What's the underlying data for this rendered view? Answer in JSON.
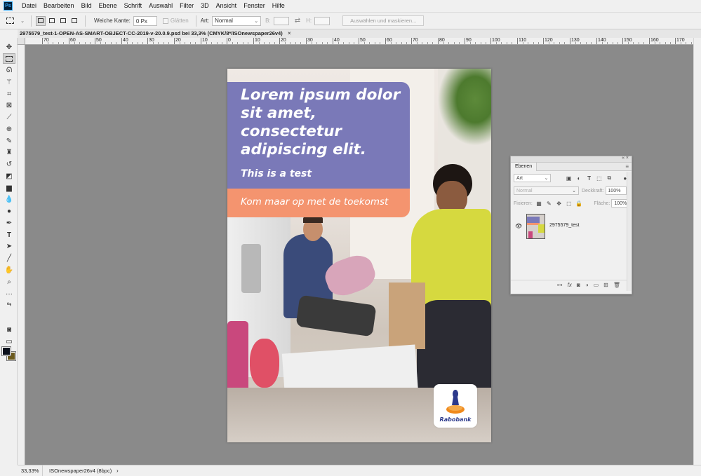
{
  "app": {
    "logo": "Ps"
  },
  "menu": [
    "Datei",
    "Bearbeiten",
    "Bild",
    "Ebene",
    "Schrift",
    "Auswahl",
    "Filter",
    "3D",
    "Ansicht",
    "Fenster",
    "Hilfe"
  ],
  "options": {
    "feather_label": "Weiche Kante:",
    "feather_value": "0 Px",
    "antialias_label": "Glätten",
    "style_label": "Art:",
    "style_value": "Normal",
    "width_label": "B:",
    "height_label": "H:",
    "select_mask_button": "Auswählen und maskieren..."
  },
  "document": {
    "tab_title": "2975579_test-1-OPEN-AS-SMART-OBJECT-CC-2019-v-20.0.9.psd bei 33,3% (CMYK/8*/ISOnewspaper26v4)",
    "close": "×"
  },
  "ruler": {
    "labels": [
      "70",
      "60",
      "50",
      "40",
      "30",
      "20",
      "10",
      "0",
      "10",
      "20",
      "30",
      "40",
      "50",
      "60",
      "70",
      "80",
      "90",
      "100",
      "110",
      "120",
      "130",
      "140",
      "150",
      "160",
      "170"
    ]
  },
  "artwork": {
    "headline": "Lorem ipsum dolor sit amet, consectetur adipiscing elit.",
    "subline": "This is a test",
    "cta": "Kom maar op met de toekomst",
    "logo_text": "Rabobank",
    "colors": {
      "headline_box": "#7a79b8",
      "cta_box": "#f4946f",
      "logo_text": "#2c3a8c"
    }
  },
  "layers_panel": {
    "tab": "Ebenen",
    "filter_value": "Art",
    "blend_mode": "Normal",
    "opacity_label": "Deckkraft:",
    "opacity_value": "100%",
    "lock_label": "Fixieren:",
    "fill_label": "Fläche:",
    "fill_value": "100%",
    "layer_name": "2975579_test"
  },
  "status": {
    "zoom": "33,33%",
    "doc_info": "ISOnewspaper26v4 (8bpc)"
  },
  "colors": {
    "foreground": "#0a0f1a",
    "background": "#6b5a1e",
    "canvas_bg": "#8a8a8a"
  }
}
